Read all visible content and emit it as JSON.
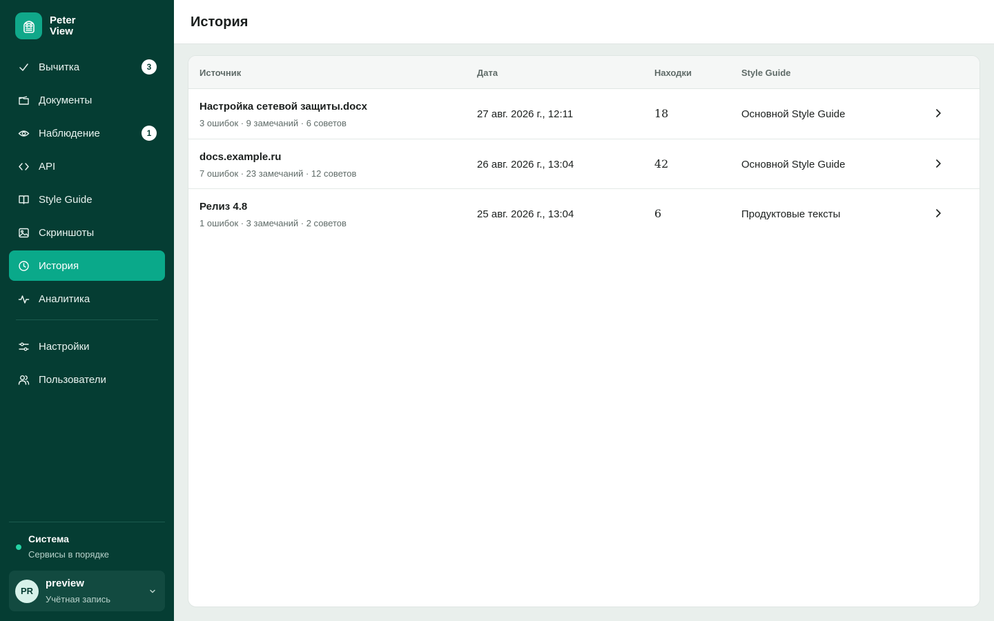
{
  "brand": {
    "name_line1": "Peter",
    "name_line2": "View",
    "icon": "robot-logo-icon"
  },
  "sidebar": {
    "items": [
      {
        "label": "Вычитка",
        "icon": "check-icon",
        "badge": "3",
        "active": false
      },
      {
        "label": "Документы",
        "icon": "folder-icon",
        "badge": "",
        "active": false
      },
      {
        "label": "Наблюдение",
        "icon": "eye-icon",
        "badge": "1",
        "active": false
      },
      {
        "label": "API",
        "icon": "code-icon",
        "badge": "",
        "active": false
      },
      {
        "label": "Style Guide",
        "icon": "book-icon",
        "badge": "",
        "active": false
      },
      {
        "label": "Скриншоты",
        "icon": "image-icon",
        "badge": "",
        "active": false
      },
      {
        "label": "История",
        "icon": "clock-icon",
        "badge": "",
        "active": true
      },
      {
        "label": "Аналитика",
        "icon": "activity-icon",
        "badge": "",
        "active": false
      }
    ],
    "bottom_items": [
      {
        "label": "Настройки",
        "icon": "sliders-icon"
      },
      {
        "label": "Пользователи",
        "icon": "users-icon"
      }
    ],
    "status": {
      "title": "Система",
      "subtitle": "Сервисы в порядке",
      "color": "#25d3a4"
    },
    "account": {
      "initials": "PR",
      "name": "preview",
      "subtitle": "Учётная запись"
    }
  },
  "header": {
    "title": "История"
  },
  "table": {
    "columns": [
      "Источник",
      "Дата",
      "Находки",
      "Style Guide"
    ],
    "rows": [
      {
        "title": "Настройка сетевой защиты.docx",
        "summary": "3 ошибок · 9 замечаний · 6 советов",
        "date": "27 авг. 2026 г., 12:11",
        "findings": "18",
        "style_guide": "Основной Style Guide"
      },
      {
        "title": "docs.example.ru",
        "summary": "7 ошибок · 23 замечаний · 12 советов",
        "date": "26 авг. 2026 г., 13:04",
        "findings": "42",
        "style_guide": "Основной Style Guide"
      },
      {
        "title": "Релиз 4.8",
        "summary": "1 ошибок · 3 замечаний · 2 советов",
        "date": "25 авг. 2026 г., 13:04",
        "findings": "6",
        "style_guide": "Продуктовые тексты"
      }
    ]
  },
  "colors": {
    "sidebar": "#053d33",
    "accent": "#0aa98a",
    "background": "#e9efec"
  }
}
